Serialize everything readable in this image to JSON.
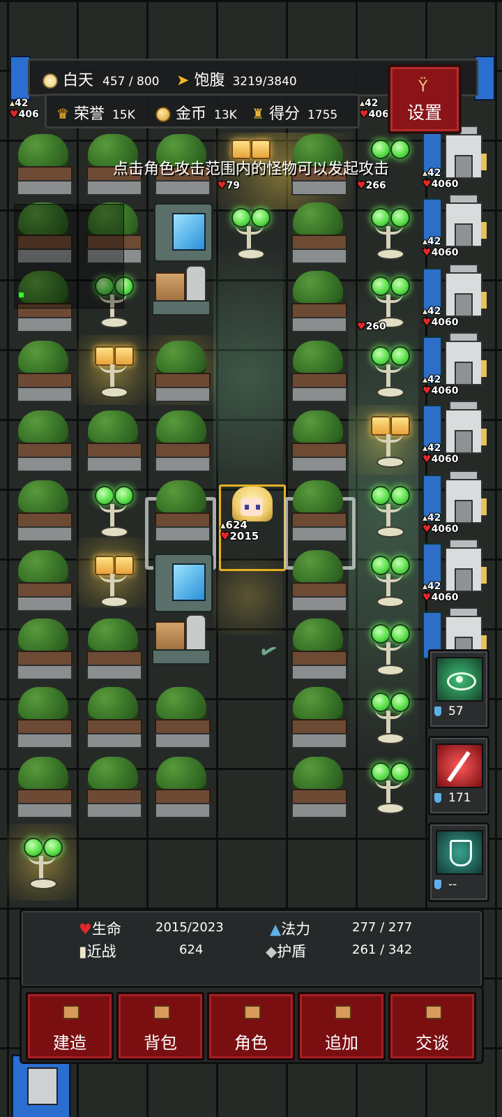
{
  "top_bar": {
    "day_label": "白天",
    "day_value": "457 / 800",
    "hunger_label": "饱腹",
    "hunger_value": "3219/3840",
    "honor_label": "荣誉",
    "honor_value": "15K",
    "gold_label": "金币",
    "gold_value": "13K",
    "score_label": "得分",
    "score_value": "1755",
    "settings_label": "设置"
  },
  "hint": "点击角色攻击范围内的怪物可以发起攻击",
  "tower_stats": {
    "attack": "42",
    "hp": "4060"
  },
  "left_edge_stats": {
    "attack": "42",
    "hp": "406"
  },
  "enemy_hp": {
    "a": "79",
    "b": "266",
    "c": "260"
  },
  "hero": {
    "attack": "624",
    "hp": "2015"
  },
  "skills": [
    {
      "name": "eye-skill",
      "cost": "57",
      "color": "#1f6b3a"
    },
    {
      "name": "sword-skill",
      "cost": "171",
      "color": "#a3161b"
    },
    {
      "name": "shield-skill",
      "cost": "--",
      "color": "#1f5a52"
    }
  ],
  "status": {
    "hp_label": "生命",
    "hp_value": "2015/2023",
    "mp_label": "法力",
    "mp_value": "277 / 277",
    "melee_label": "近战",
    "melee_value": "624",
    "shield_label": "护盾",
    "shield_value": "261 / 342"
  },
  "nav": {
    "build": "建造",
    "bag": "背包",
    "character": "角色",
    "add": "追加",
    "talk": "交谈"
  }
}
